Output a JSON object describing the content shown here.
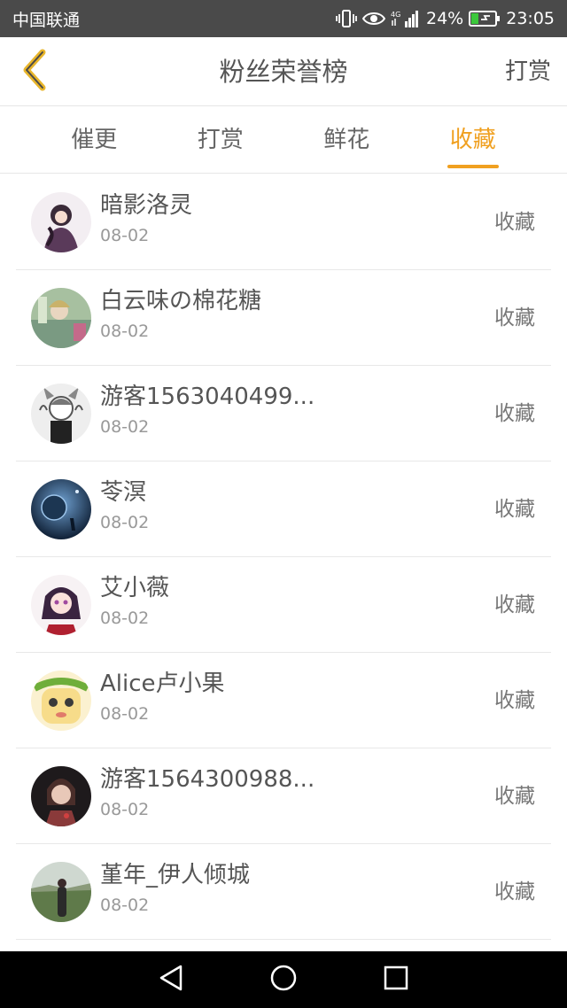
{
  "status_bar": {
    "carrier": "中国联通",
    "network": "4G",
    "battery": "24%",
    "time": "23:05",
    "icons": [
      "vibrate-icon",
      "eye-icon",
      "signal-icon",
      "battery-icon"
    ]
  },
  "header": {
    "title": "粉丝荣誉榜",
    "action_label": "打赏",
    "back_icon": "back-chevron-icon"
  },
  "colors": {
    "accent": "#f0a020",
    "text": "#555555",
    "muted": "#999999"
  },
  "tabs": [
    {
      "label": "催更",
      "active": false
    },
    {
      "label": "打赏",
      "active": false
    },
    {
      "label": "鲜花",
      "active": false
    },
    {
      "label": "收藏",
      "active": true
    }
  ],
  "fans": [
    {
      "name": "暗影洛灵",
      "date": "08-02",
      "tag": "收藏"
    },
    {
      "name": "白云味の棉花糖",
      "date": "08-02",
      "tag": "收藏"
    },
    {
      "name": "游客1563040499...",
      "date": "08-02",
      "tag": "收藏"
    },
    {
      "name": "苓溟",
      "date": "08-02",
      "tag": "收藏"
    },
    {
      "name": "艾小薇",
      "date": "08-02",
      "tag": "收藏"
    },
    {
      "name": "Alice卢小果",
      "date": "08-02",
      "tag": "收藏"
    },
    {
      "name": "游客1564300988...",
      "date": "08-02",
      "tag": "收藏"
    },
    {
      "name": "堇年_伊人倾城",
      "date": "08-02",
      "tag": "收藏"
    }
  ],
  "nav": {
    "back_icon": "nav-back-triangle-icon",
    "home_icon": "nav-home-circle-icon",
    "recents_icon": "nav-recents-square-icon"
  }
}
